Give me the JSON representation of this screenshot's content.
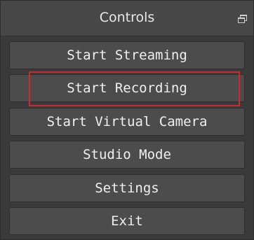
{
  "dock": {
    "title": "Controls",
    "float_icon": "undock-window-icon"
  },
  "buttons": [
    {
      "label": "Start Streaming"
    },
    {
      "label": "Start Recording"
    },
    {
      "label": "Start Virtual Camera"
    },
    {
      "label": "Studio Mode"
    },
    {
      "label": "Settings"
    },
    {
      "label": "Exit"
    }
  ],
  "annotation": {
    "highlight_color": "#d8242b",
    "highlighted_button": "Start Recording"
  }
}
